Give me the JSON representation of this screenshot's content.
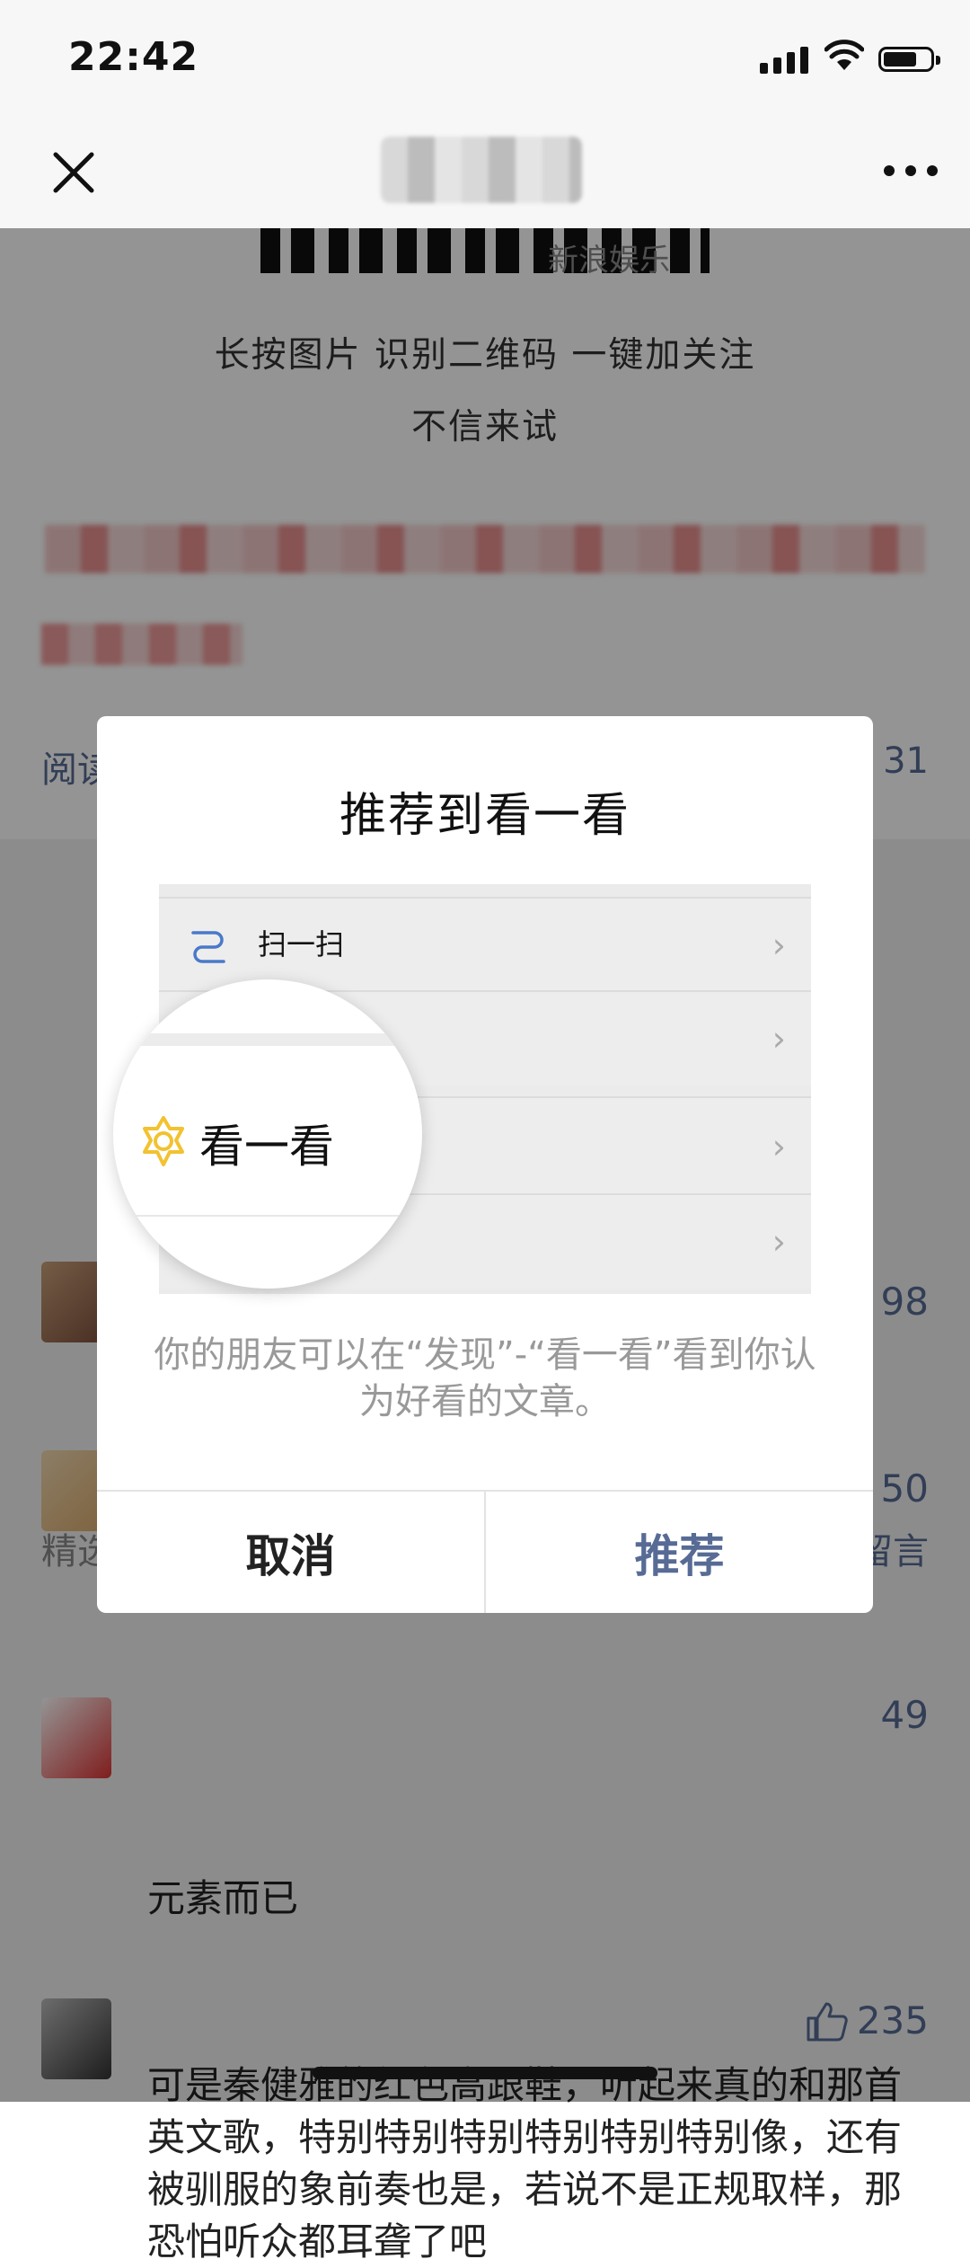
{
  "status_bar": {
    "time": "22:42"
  },
  "nav": {
    "title_hidden": true
  },
  "article": {
    "qr_caption": "新浪娱乐",
    "promo_line1": "长按图片 识别二维码 一键加关注",
    "promo_line2": "不信来试",
    "read_label": "阅读",
    "read_count": "31"
  },
  "comments": {
    "section_title": "精选留言",
    "write_label": "留言",
    "items": [
      {
        "likes": "98",
        "text": ""
      },
      {
        "likes": "50",
        "text": ""
      },
      {
        "likes": "49",
        "text": "元素而已"
      },
      {
        "likes": "235",
        "text": "可是秦健雅的红色高跟鞋，听起来真的和那首英文歌，特别特别特别特别特别特别像，还有被驯服的象前奏也是，若说不是正规取样，那恐怕听众都耳聋了吧"
      }
    ]
  },
  "dialog": {
    "title": "推荐到看一看",
    "illustration": {
      "scan_label": "扫一扫",
      "highlight_label": "看一看"
    },
    "description": "你的朋友可以在“发现”-“看一看”看到你认为好看的文章。",
    "cancel_label": "取消",
    "recommend_label": "推荐"
  },
  "colors": {
    "link_blue": "#576b95",
    "icon_yellow": "#f2c230",
    "scan_icon_blue": "#4a79c8"
  }
}
